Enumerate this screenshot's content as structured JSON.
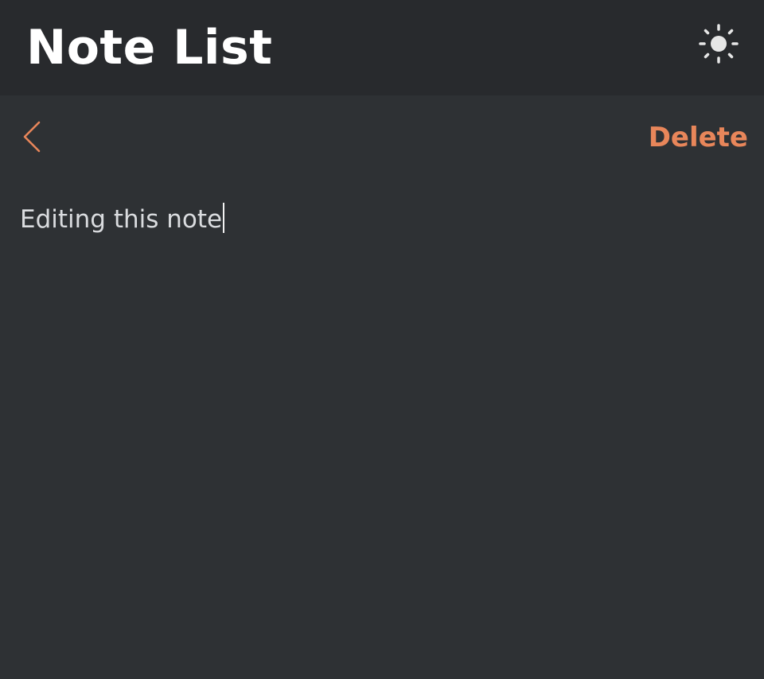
{
  "header": {
    "title": "Note List",
    "theme_toggle_icon": "sun-icon"
  },
  "toolbar": {
    "back_icon": "chevron-left-icon",
    "delete_label": "Delete"
  },
  "editor": {
    "text": "Editing this note"
  },
  "colors": {
    "accent": "#e8865a",
    "header_bg": "#282a2d",
    "page_bg": "#2e3134",
    "title_text": "#ffffff",
    "body_text": "#dadcdf",
    "icon": "#e6e6e6"
  }
}
